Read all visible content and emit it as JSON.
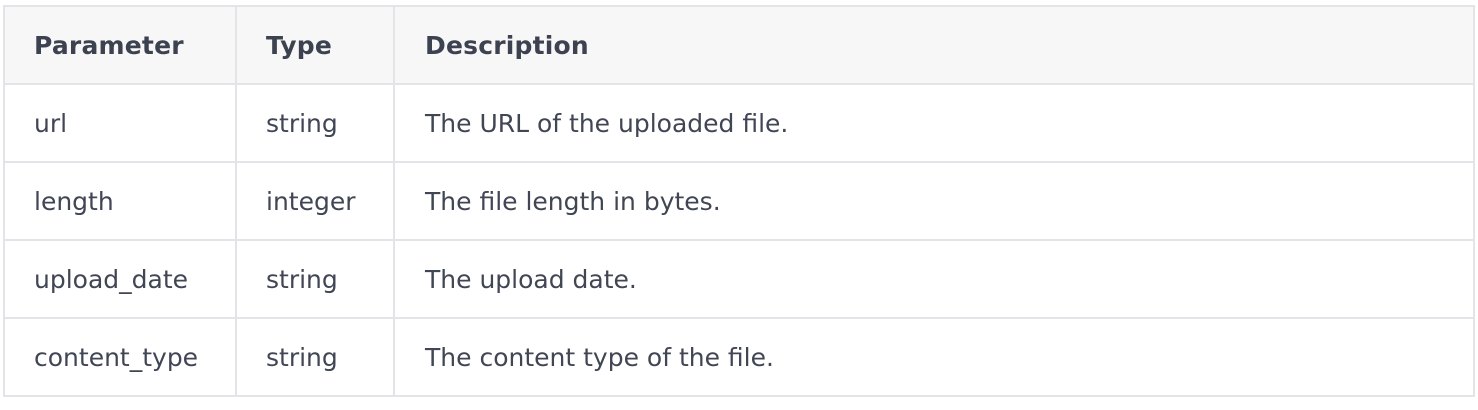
{
  "table": {
    "headers": {
      "parameter": "Parameter",
      "type": "Type",
      "description": "Description"
    },
    "rows": [
      {
        "parameter": "url",
        "type": "string",
        "description": "The URL of the uploaded file."
      },
      {
        "parameter": "length",
        "type": "integer",
        "description": "The file length in bytes."
      },
      {
        "parameter": "upload_date",
        "type": "string",
        "description": "The upload date."
      },
      {
        "parameter": "content_type",
        "type": "string",
        "description": "The content type of the file."
      }
    ]
  },
  "colors": {
    "header_background": "#f7f7f8",
    "border": "#e3e4e8",
    "text": "#414654"
  }
}
